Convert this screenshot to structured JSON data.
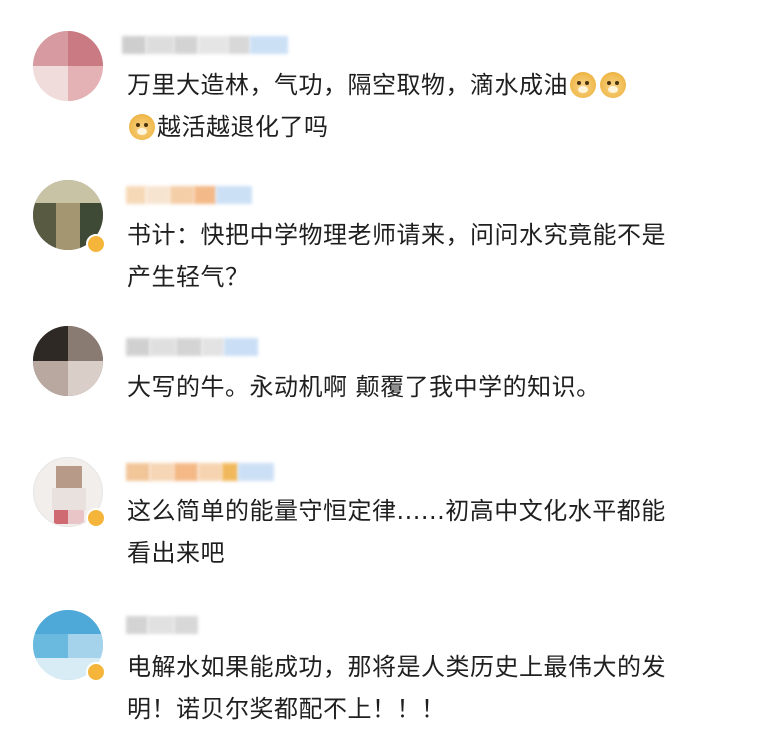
{
  "comments": [
    {
      "username": "",
      "lines": [
        "万里大造林，气功，隔空取物，滴水成油",
        "越活越退化了吗"
      ],
      "emoji_name": "doge-emoji"
    },
    {
      "username": "",
      "lines": [
        "书计：快把中学物理老师请来，问问水究竟能不是",
        "产生轻气？"
      ]
    },
    {
      "username": "",
      "lines": [
        "大写的牛。永动机啊 颠覆了我中学的知识。"
      ]
    },
    {
      "username": "",
      "lines": [
        "这么简单的能量守恒定律......初高中文化水平都能",
        "看出来吧"
      ]
    },
    {
      "username": "",
      "lines": [
        "电解水如果能成功，那将是人类历史上最伟大的发",
        "明！诺贝尔奖都配不上！！！"
      ]
    }
  ],
  "colors": {
    "text": "#1f1f1f",
    "vip_badge": "#f5b53a",
    "name_highlight": "#f3b27a"
  }
}
